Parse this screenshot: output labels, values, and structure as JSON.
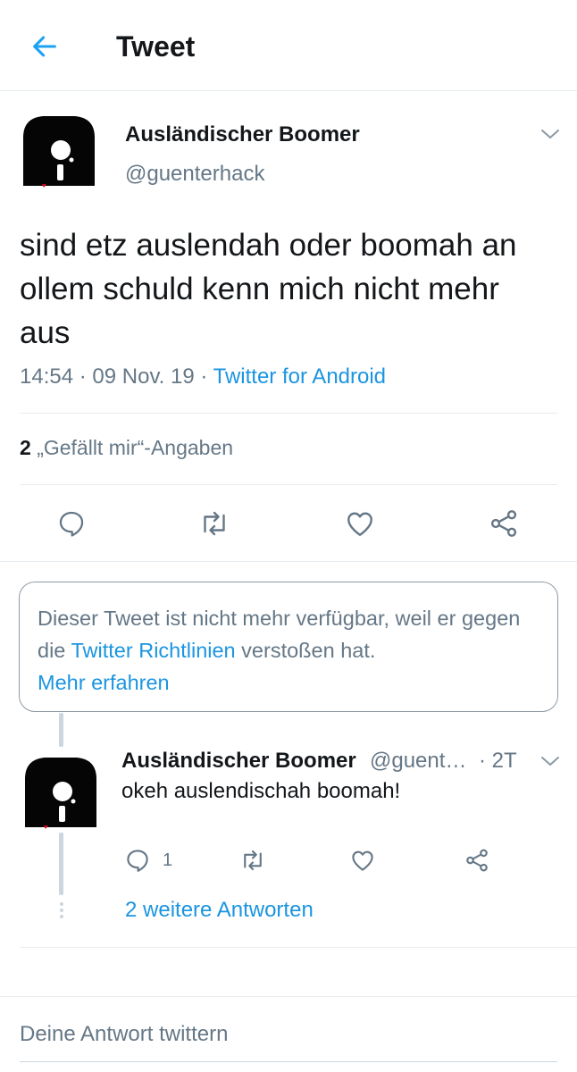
{
  "header": {
    "title": "Tweet",
    "back_icon": "arrow-left-icon",
    "accent_color": "#1da1f2"
  },
  "main_tweet": {
    "author_name": "Ausländischer Boomer",
    "handle": "@guenterhack",
    "text": "sind etz auslendah oder boomah an ollem schuld kenn mich nicht mehr aus",
    "time": "14:54",
    "date": "09 Nov. 19",
    "separator": "·",
    "source": "Twitter for Android",
    "likes_count": "2",
    "likes_label": "„Gefällt mir“-Angaben",
    "actions": [
      "reply-icon",
      "retweet-icon",
      "like-icon",
      "share-icon"
    ]
  },
  "unavailable_notice": {
    "text_1": "Dieser Tweet ist nicht mehr verfügbar, weil er gegen die",
    "link_rules": "Twitter Richtlinien",
    "text_2": "verstoßen hat.",
    "link_more": "Mehr erfahren"
  },
  "reply_tweet": {
    "author_name": "Ausländischer Boomer",
    "handle": "@guent…",
    "time": "· 2T",
    "text": "okeh auslendischah boomah!",
    "reply_count": "1",
    "more_replies": "2 weitere Antworten"
  },
  "compose": {
    "placeholder": "Deine Antwort twittern"
  }
}
